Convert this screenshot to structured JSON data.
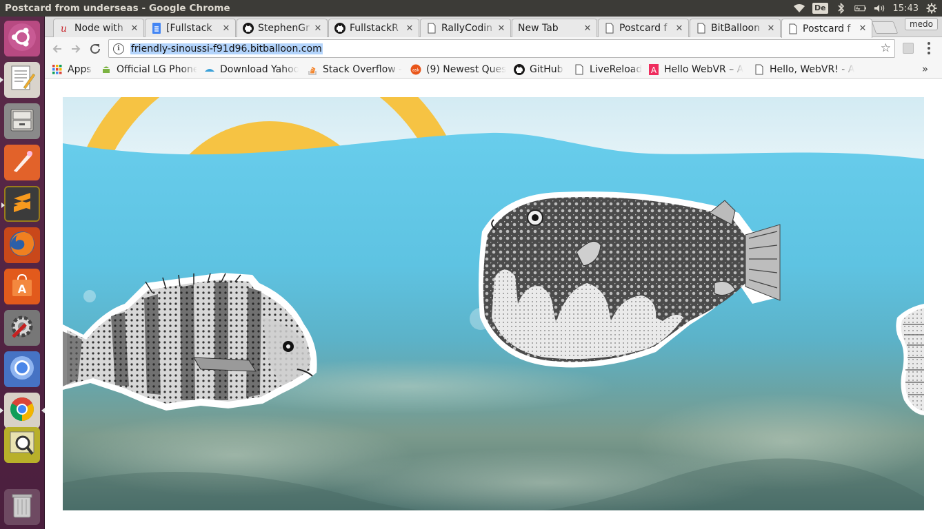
{
  "window": {
    "title": "Postcard from underseas - Google Chrome"
  },
  "panel": {
    "keyboard_layout": "De",
    "clock": "15:43",
    "icons": [
      "wifi-icon",
      "keyboard-icon",
      "bluetooth-icon",
      "battery-icon",
      "volume-icon",
      "settings-gear-icon"
    ]
  },
  "launcher": {
    "items": [
      {
        "name": "ubuntu-dash",
        "icon": "ubuntu-logo-icon"
      },
      {
        "name": "text-editor",
        "icon": "text-editor-icon"
      },
      {
        "name": "file-manager",
        "icon": "file-cabinet-icon"
      },
      {
        "name": "inkscape",
        "icon": "pen-tool-icon"
      },
      {
        "name": "sublime-text",
        "icon": "sublime-icon"
      },
      {
        "name": "firefox",
        "icon": "firefox-icon"
      },
      {
        "name": "software-center",
        "icon": "software-bag-icon"
      },
      {
        "name": "system-settings",
        "icon": "settings-icon"
      },
      {
        "name": "chromium",
        "icon": "chromium-icon"
      },
      {
        "name": "google-chrome",
        "icon": "chrome-icon"
      },
      {
        "name": "image-viewer",
        "icon": "magnifier-icon"
      },
      {
        "name": "trash",
        "icon": "trash-icon"
      }
    ]
  },
  "tabs": [
    {
      "label": "Node with",
      "favicon": "red-script-icon"
    },
    {
      "label": "[Fullstack",
      "favicon": "google-docs-icon"
    },
    {
      "label": "StephenGr",
      "favicon": "github-icon"
    },
    {
      "label": "FullstackR",
      "favicon": "github-icon"
    },
    {
      "label": "RallyCodin",
      "favicon": "page-icon"
    },
    {
      "label": "New Tab",
      "favicon": "none"
    },
    {
      "label": "Postcard f",
      "favicon": "page-icon"
    },
    {
      "label": "BitBalloon",
      "favicon": "page-icon"
    },
    {
      "label": "Postcard f",
      "favicon": "page-icon",
      "active": true
    }
  ],
  "profile": {
    "name": "medo"
  },
  "omnibox": {
    "url": "friendly-sinoussi-f91d96.bitballoon.com"
  },
  "bookmarks": [
    {
      "label": "Apps",
      "favicon": "apps-grid-icon"
    },
    {
      "label": "Official LG Phone",
      "favicon": "android-icon"
    },
    {
      "label": "Download Yahoo",
      "favicon": "yahoo-icon"
    },
    {
      "label": "Stack Overflow -",
      "favicon": "stackoverflow-icon"
    },
    {
      "label": "(9) Newest Ques",
      "favicon": "askubuntu-icon"
    },
    {
      "label": "GitHub",
      "favicon": "github-icon"
    },
    {
      "label": "LiveReload",
      "favicon": "page-icon"
    },
    {
      "label": "Hello WebVR – A",
      "favicon": "aframe-icon"
    },
    {
      "label": "Hello, WebVR! - A",
      "favicon": "page-icon"
    }
  ],
  "bookmarks_overflow": "»",
  "postcard": {
    "sky_color": "#e6f3f8",
    "sun_color": "#f6c343",
    "water_color": "#6dcbe9",
    "elements": [
      "sun",
      "wave",
      "sheepshead-fish",
      "pufferfish",
      "seahorse",
      "bubbles",
      "sand-floor"
    ]
  }
}
